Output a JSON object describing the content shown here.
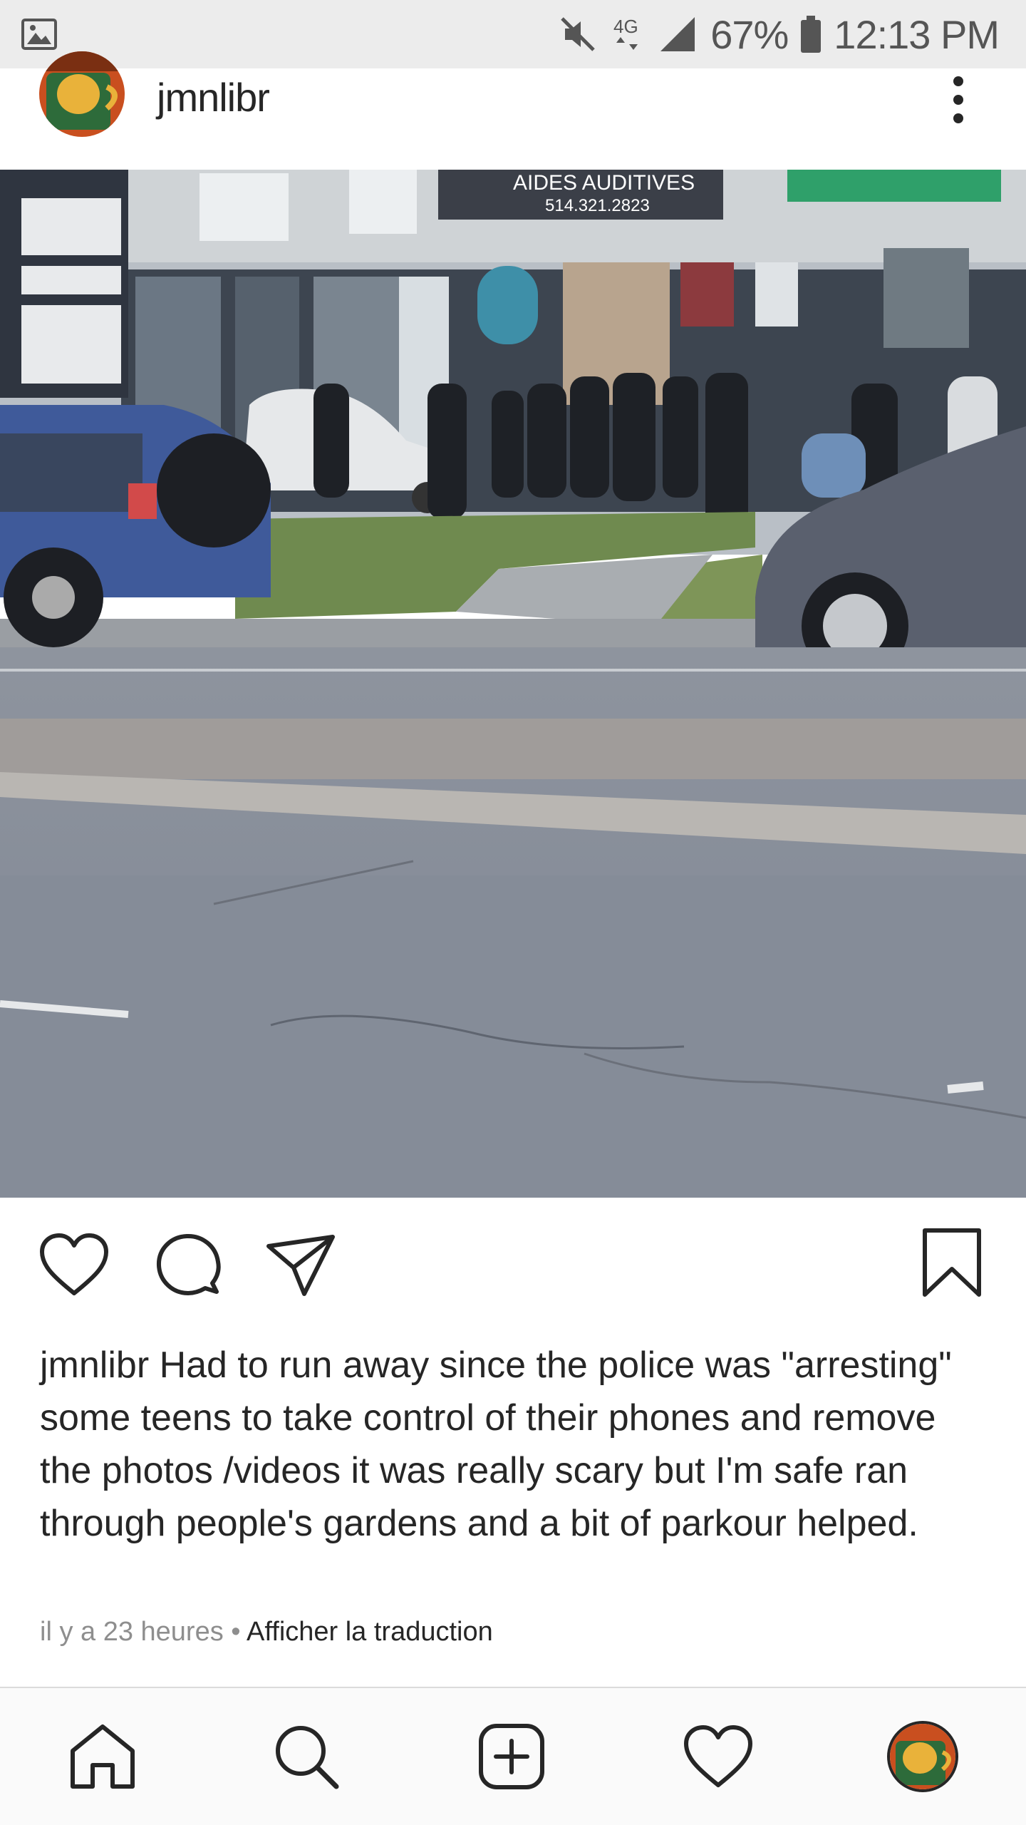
{
  "status_bar": {
    "battery_percent": "67%",
    "time": "12:13 PM",
    "network": "4G",
    "icons": [
      "gallery-icon",
      "mute-icon",
      "network-4g-icon",
      "signal-icon",
      "battery-icon"
    ]
  },
  "post": {
    "username": "jmnlibr",
    "photo_signs": {
      "sign_main": "AIDES AUDITIVES",
      "sign_phone": "514.321.2823"
    },
    "caption_username": "jmnlibr",
    "caption_text": " Had to run away since the police was \"arresting\" some teens to take control of their phones and remove the photos /videos it was really scary but I'm safe ran through people's gardens and a bit of parkour helped.",
    "time_ago": "il y a 23 heures",
    "separator": " • ",
    "translate_label": "Afficher la traduction"
  },
  "actions": [
    "like-icon",
    "comment-icon",
    "share-icon",
    "save-icon"
  ],
  "bottom_nav": [
    "home-icon",
    "search-icon",
    "new-post-icon",
    "activity-icon",
    "profile-avatar"
  ]
}
